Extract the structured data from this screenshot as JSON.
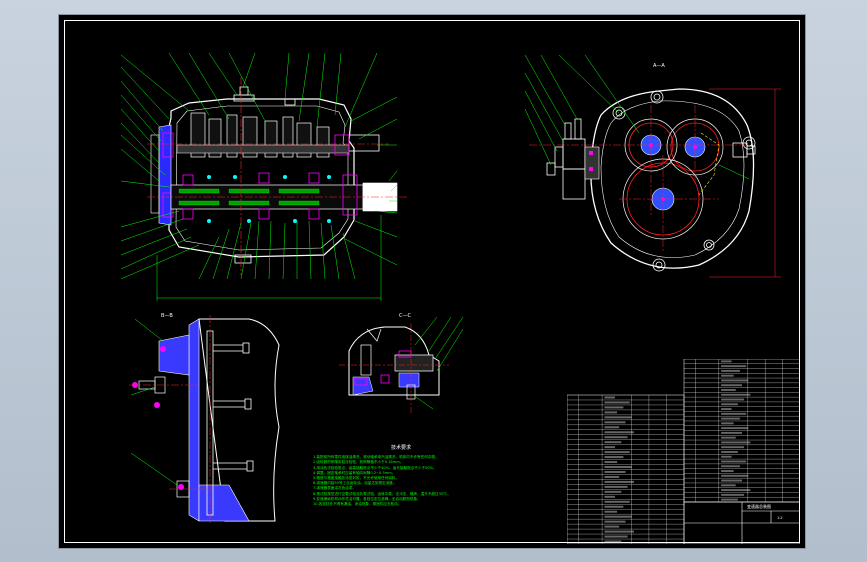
{
  "drawing": {
    "views": {
      "top_right": "A—A",
      "bottom_left": "B—B",
      "bottom_mid": "C—C"
    },
    "notes_title": "技术要求",
    "notes": [
      "1.装配前所有零件用煤油清洗，滚动轴承用汽油清洗，机体内不许有任何杂物。",
      "2.齿轮副的侧隙用铅丝检验，其侧隙值不小于0.16mm。",
      "3.用涂色法检验斑点，齿高接触斑点不少于40%，齿长接触斑点不少于50%。",
      "4.调整、固定轴承时应留有轴向间隙0.2~0.5mm。",
      "5.箱座与箱盖接触处涂密封胶，不允许使用任何填料。",
      "6.减速器内装50号工业齿轮油，油量达到规定深度。",
      "7.减速器表面涂灰色油漆。",
      "8.按试验规范进行空载试验及负载试验，运转平稳，无冲击、噪声，温升不超过35℃。",
      "9.变速操纵机构动作灵活可靠，各档位定位准确，无自动脱档现象。",
      "10.各密封处不得有漏油、渗油现象，紧固件应无松动。"
    ],
    "title_block": {
      "drawing_name": "变速器总装图",
      "scale": "1:2"
    }
  },
  "colors": {
    "background": "#000000",
    "outline": "#ffffff",
    "leader": "#00ff00",
    "centerline": "#ff2020",
    "hidden": "#ffff00",
    "section": "#3030ff",
    "gear_hub": "#4060ff",
    "magenta": "#ff00ff"
  }
}
